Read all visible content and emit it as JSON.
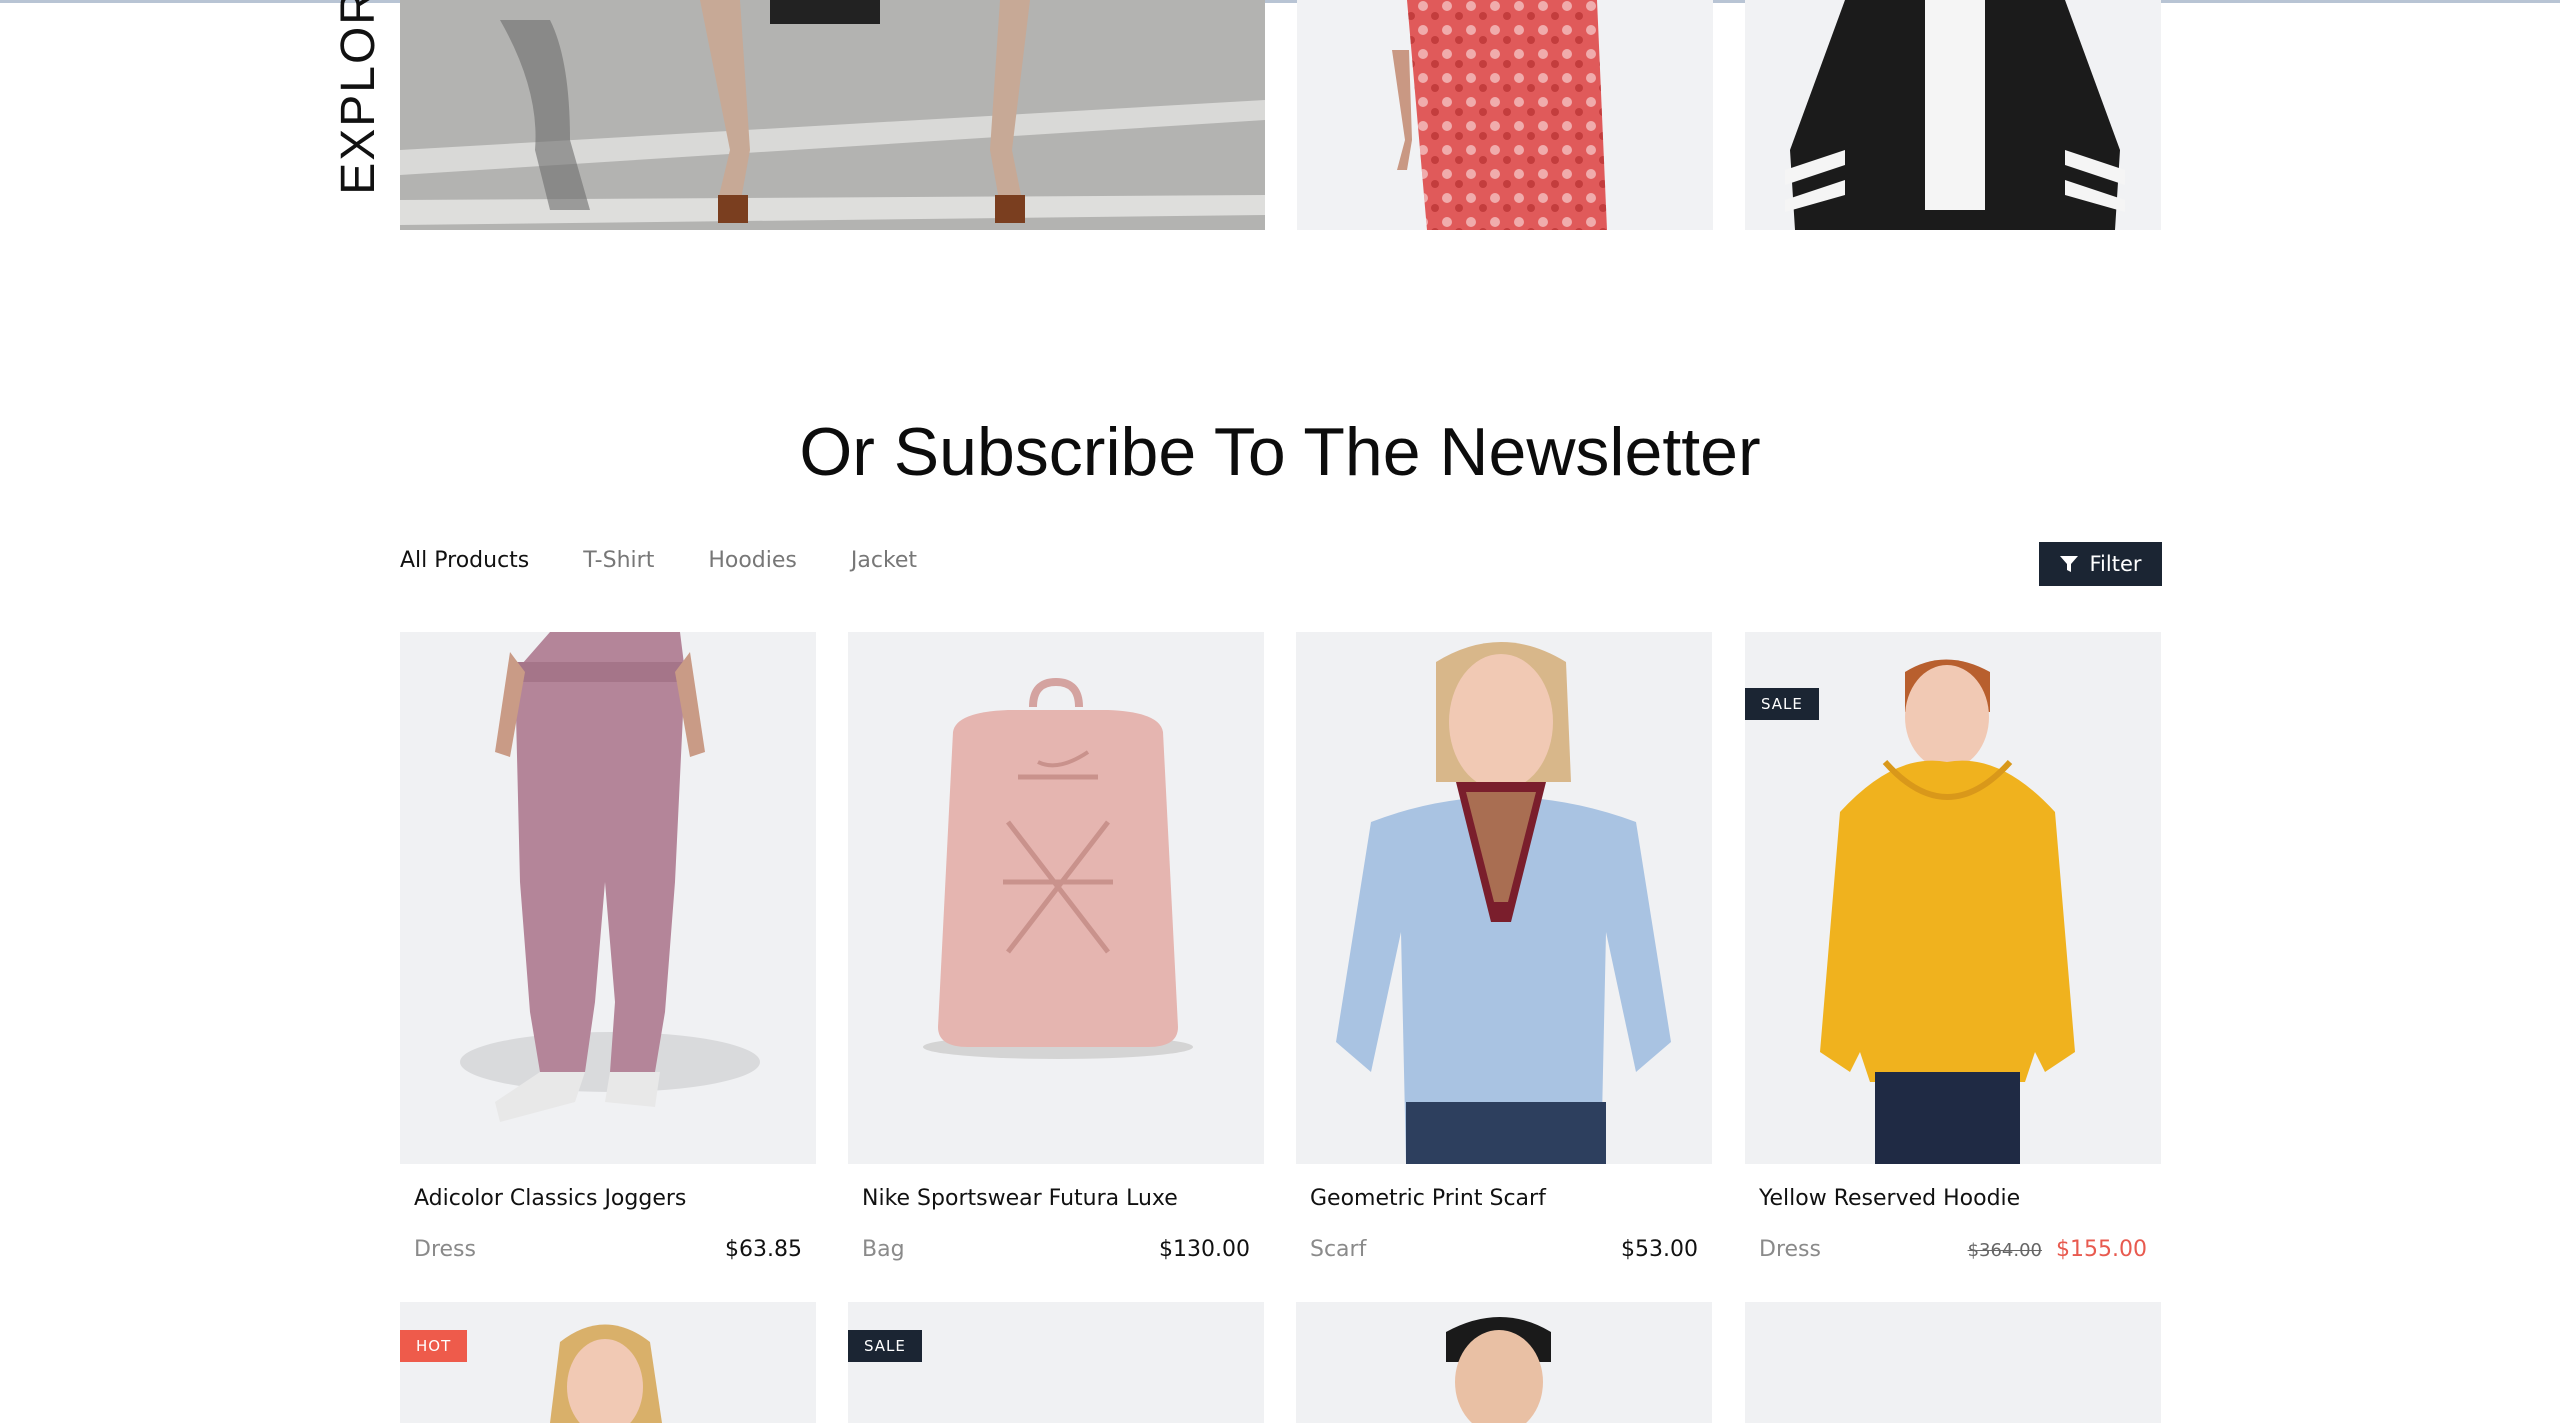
{
  "explore": {
    "label": "EXPLORE"
  },
  "newsletter": {
    "title": "Or Subscribe To The Newsletter"
  },
  "tabs": [
    {
      "label": "All Products",
      "active": true
    },
    {
      "label": "T-Shirt",
      "active": false
    },
    {
      "label": "Hoodies",
      "active": false
    },
    {
      "label": "Jacket",
      "active": false
    }
  ],
  "filter": {
    "label": "Filter"
  },
  "products": [
    {
      "name": "Adicolor Classics Joggers",
      "category": "Dress",
      "price": "$63.85",
      "old_price": "",
      "badge": ""
    },
    {
      "name": "Nike Sportswear Futura Luxe",
      "category": "Bag",
      "price": "$130.00",
      "old_price": "",
      "badge": ""
    },
    {
      "name": "Geometric Print Scarf",
      "category": "Scarf",
      "price": "$53.00",
      "old_price": "",
      "badge": ""
    },
    {
      "name": "Yellow Reserved Hoodie",
      "category": "Dress",
      "price": "$155.00",
      "old_price": "$364.00",
      "badge": "SALE"
    }
  ],
  "products_row2": [
    {
      "badge": "HOT"
    },
    {
      "badge": "SALE"
    },
    {
      "badge": ""
    },
    {
      "badge": ""
    }
  ],
  "colors": {
    "dark": "#1b2533",
    "sale_red": "#e85a4f",
    "hot": "#ee5b4b",
    "image_bg": "#f0f1f3"
  }
}
